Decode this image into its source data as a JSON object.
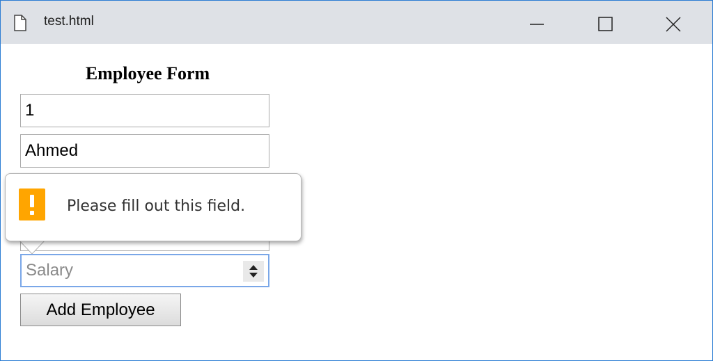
{
  "window": {
    "title": "test.html",
    "icons": {
      "document": "document-icon",
      "minimize": "minimize-icon",
      "maximize": "maximize-icon",
      "close": "close-icon"
    },
    "titlebar_color": "#dee1e6",
    "border_color": "#2b7cd3"
  },
  "form": {
    "title": "Employee Form",
    "id_value": "1",
    "name_value": "Ahmed",
    "salary_placeholder": "Salary",
    "submit_label": "Add Employee"
  },
  "validation": {
    "message": "Please fill out this field.",
    "icon": "warning-icon",
    "icon_color": "#ffa500"
  }
}
